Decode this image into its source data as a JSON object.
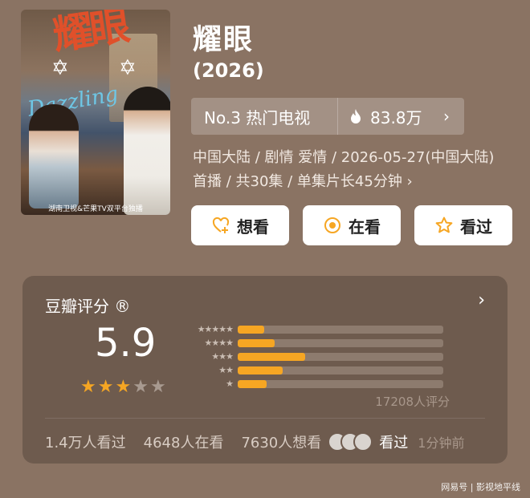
{
  "poster": {
    "title_art": "耀眼",
    "subtitle_art": "Dazzling",
    "bottom_text": "湖南卫视&芒果TV双平台独播"
  },
  "show": {
    "title": "耀眼",
    "year": "(2026)",
    "rank": "No.3 热门电视",
    "heat": "83.8万",
    "meta": "中国大陆 / 剧情 爱情 / 2026-05-27(中国大陆)首播 / 共30集 / 单集片长45分钟 ›"
  },
  "actions": {
    "want": "想看",
    "watching": "在看",
    "watched": "看过"
  },
  "rating": {
    "label": "豆瓣评分",
    "registered": "®",
    "score": "5.9",
    "stars_filled": 3,
    "stars_total": 5,
    "count": "17208人评分",
    "distribution": [
      {
        "stars": "★★★★★",
        "pct": 0.13
      },
      {
        "stars": "★★★★",
        "pct": 0.18
      },
      {
        "stars": "★★★",
        "pct": 0.33
      },
      {
        "stars": "★★",
        "pct": 0.22
      },
      {
        "stars": "★",
        "pct": 0.14
      }
    ]
  },
  "footer": {
    "watched_count": "1.4万人看过",
    "watching_count": "4648人在看",
    "want_count": "7630人想看",
    "friend_action": "看过",
    "time": "1分钟前"
  },
  "watermark": "网易号 | 影视地平线",
  "colors": {
    "background": "#8a7363",
    "card": "#6e5b4e",
    "accent": "#f6a623"
  }
}
